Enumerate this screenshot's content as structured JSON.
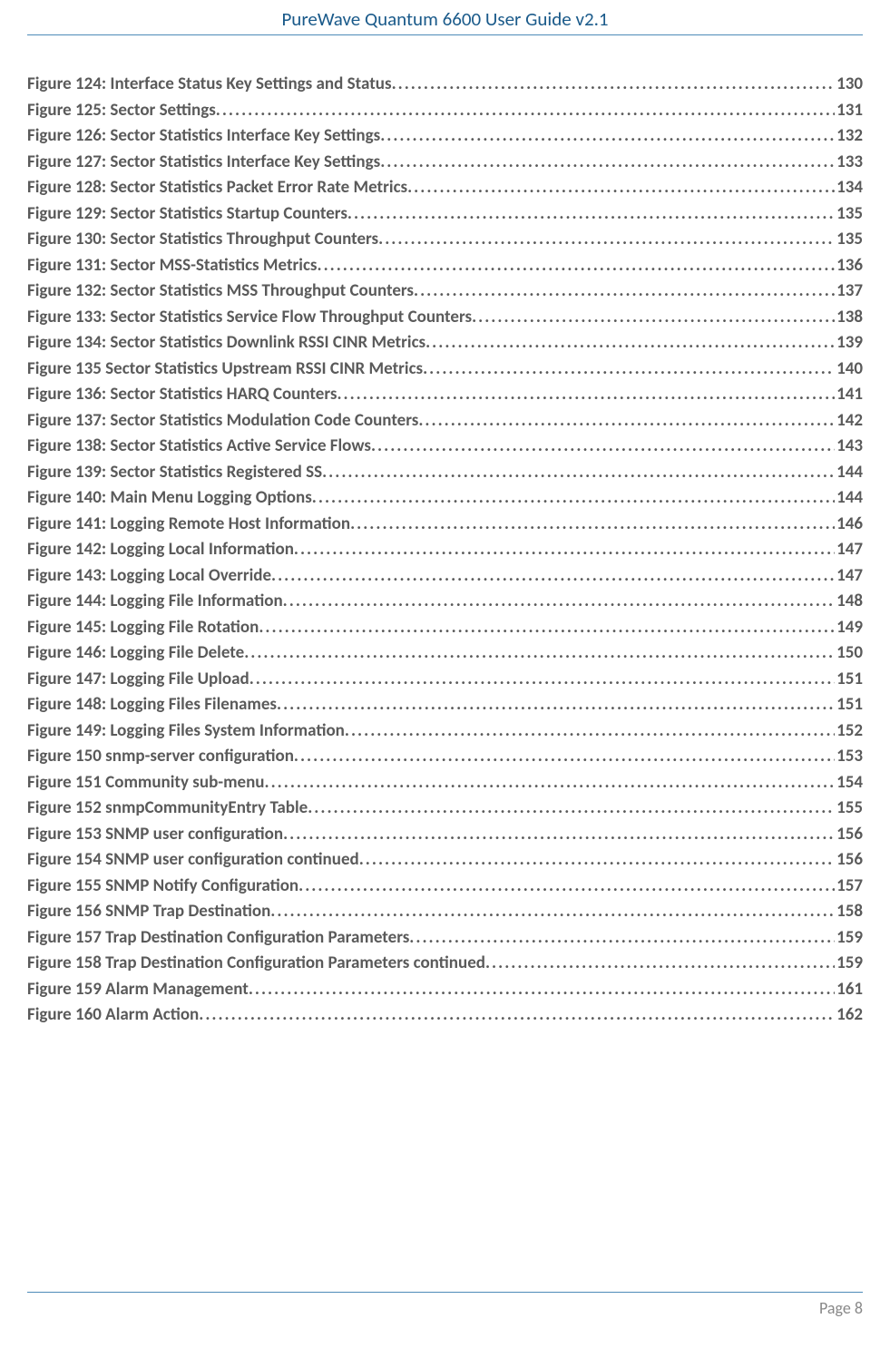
{
  "header": {
    "title": "PureWave Quantum 6600 User Guide v2.1"
  },
  "toc": [
    {
      "label": "Figure 124: Interface Status Key Settings and Status",
      "page": "130"
    },
    {
      "label": "Figure 125: Sector Settings",
      "page": "131"
    },
    {
      "label": "Figure 126: Sector Statistics Interface Key Settings",
      "page": "132"
    },
    {
      "label": "Figure 127: Sector Statistics Interface Key Settings",
      "page": "133"
    },
    {
      "label": "Figure 128: Sector Statistics Packet Error Rate Metrics",
      "page": "134"
    },
    {
      "label": "Figure 129: Sector Statistics Startup Counters",
      "page": "135"
    },
    {
      "label": "Figure 130: Sector Statistics Throughput Counters",
      "page": "135"
    },
    {
      "label": "Figure 131: Sector MSS-Statistics Metrics",
      "page": "136"
    },
    {
      "label": "Figure 132: Sector Statistics MSS Throughput Counters",
      "page": "137"
    },
    {
      "label": "Figure 133: Sector Statistics Service Flow Throughput Counters",
      "page": "138"
    },
    {
      "label": "Figure 134: Sector Statistics Downlink RSSI CINR Metrics",
      "page": "139"
    },
    {
      "label": "Figure 135 Sector Statistics Upstream RSSI CINR Metrics",
      "page": "140"
    },
    {
      "label": "Figure 136: Sector Statistics HARQ Counters",
      "page": "141"
    },
    {
      "label": "Figure 137: Sector Statistics Modulation Code Counters",
      "page": "142"
    },
    {
      "label": "Figure 138: Sector Statistics Active Service Flows",
      "page": "143"
    },
    {
      "label": "Figure 139: Sector Statistics Registered SS",
      "page": "144"
    },
    {
      "label": "Figure 140: Main Menu Logging Options",
      "page": "144"
    },
    {
      "label": "Figure 141: Logging Remote Host Information",
      "page": "146"
    },
    {
      "label": "Figure 142: Logging Local Information",
      "page": "147"
    },
    {
      "label": "Figure 143: Logging Local Override",
      "page": "147"
    },
    {
      "label": "Figure 144: Logging File Information",
      "page": "148"
    },
    {
      "label": "Figure 145: Logging File Rotation",
      "page": "149"
    },
    {
      "label": "Figure 146: Logging File Delete",
      "page": "150"
    },
    {
      "label": "Figure 147: Logging File Upload",
      "page": "151"
    },
    {
      "label": "Figure 148: Logging Files Filenames",
      "page": "151"
    },
    {
      "label": "Figure 149: Logging Files System Information",
      "page": "152"
    },
    {
      "label": "Figure 150 snmp-server configuration",
      "page": "153"
    },
    {
      "label": "Figure 151 Community sub-menu",
      "page": "154"
    },
    {
      "label": "Figure 152 snmpCommunityEntry Table",
      "page": "155"
    },
    {
      "label": "Figure 153 SNMP user configuration",
      "page": "156"
    },
    {
      "label": "Figure 154 SNMP user configuration continued",
      "page": "156"
    },
    {
      "label": "Figure 155 SNMP Notify Configuration",
      "page": "157"
    },
    {
      "label": "Figure 156 SNMP Trap Destination",
      "page": "158"
    },
    {
      "label": "Figure 157 Trap Destination Configuration Parameters",
      "page": "159"
    },
    {
      "label": "Figure 158 Trap Destination Configuration Parameters continued",
      "page": "159"
    },
    {
      "label": "Figure 159 Alarm Management",
      "page": "161"
    },
    {
      "label": "Figure 160 Alarm Action",
      "page": "162"
    }
  ],
  "footer": {
    "page_label": "Page 8"
  }
}
